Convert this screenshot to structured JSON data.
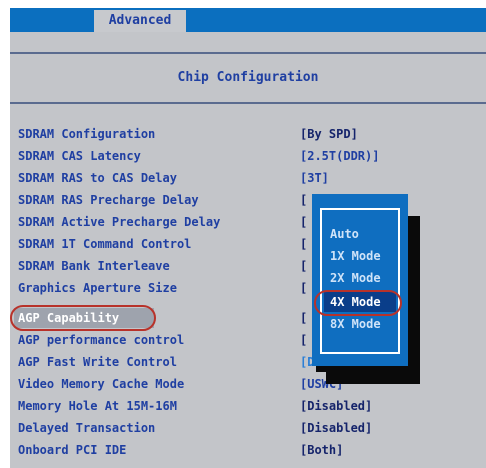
{
  "menubar": {
    "tab": "Advanced"
  },
  "header": {
    "title": "Chip Configuration"
  },
  "rows": [
    {
      "label": "SDRAM Configuration",
      "value": "[By SPD]"
    },
    {
      "label": "SDRAM CAS Latency",
      "value": "[2.5T(DDR)]"
    },
    {
      "label": "SDRAM RAS to CAS Delay",
      "value": "[3T]"
    },
    {
      "label": "SDRAM RAS Precharge Delay",
      "value": "["
    },
    {
      "label": "SDRAM Active Precharge Delay",
      "value": "["
    },
    {
      "label": "SDRAM 1T Command Control",
      "value": "["
    },
    {
      "label": "SDRAM Bank Interleave",
      "value": "["
    },
    {
      "label": "Graphics Aperture Size",
      "value": "["
    },
    {
      "label": "AGP Capability",
      "value": "["
    },
    {
      "label": "AGP performance control",
      "value": "["
    },
    {
      "label": "AGP Fast Write Control",
      "value": "[Disabled]"
    },
    {
      "label": "Video Memory Cache Mode",
      "value": "[USWC]"
    },
    {
      "label": "Memory Hole At 15M-16M",
      "value": "[Disabled]"
    },
    {
      "label": "Delayed Transaction",
      "value": "[Disabled]"
    },
    {
      "label": "Onboard PCI IDE",
      "value": "[Both]"
    }
  ],
  "popup": {
    "options": [
      "Auto",
      "1X Mode",
      "2X Mode",
      "4X Mode",
      "8X Mode"
    ],
    "selected": "4X Mode"
  },
  "colors": {
    "menubar": "#0b6fbf",
    "background": "#c3c5c9",
    "label_text": "#1f3fa2",
    "popup": "#0f6ec0",
    "annotation_ring": "#b8322a"
  }
}
